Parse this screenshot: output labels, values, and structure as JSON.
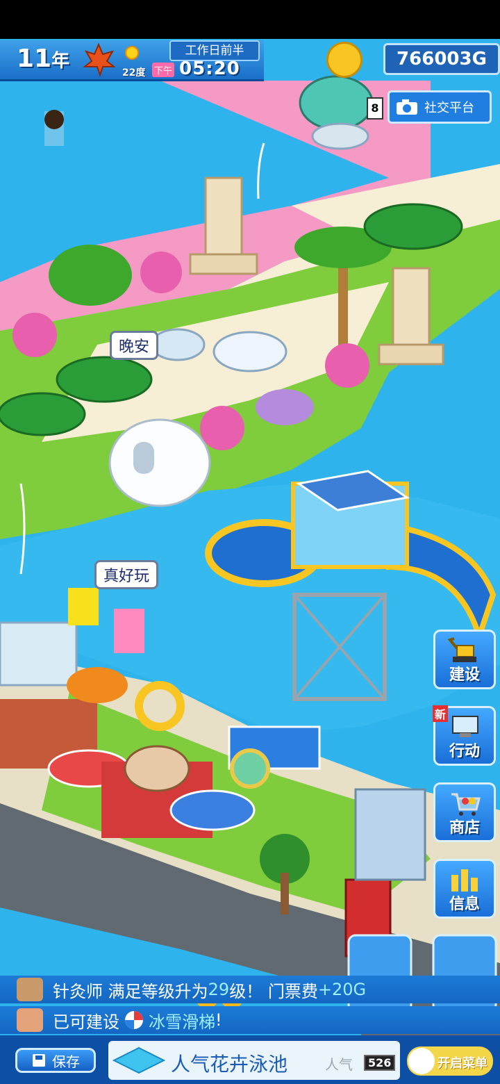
{
  "status": {
    "year": "11",
    "year_unit": "年",
    "temperature": "22度",
    "period": "工作日前半",
    "ampm": "下午",
    "time": "05:20",
    "money": "766003G"
  },
  "social": {
    "count": "8",
    "label": "社交平台"
  },
  "bubbles": [
    "晚安",
    "真好玩"
  ],
  "side_buttons": [
    {
      "label": "建设",
      "icon": "excavator-icon"
    },
    {
      "label": "行动",
      "icon": "computer-icon",
      "badge": "新"
    },
    {
      "label": "商店",
      "icon": "shopping-cart-icon"
    },
    {
      "label": "信息",
      "icon": "chart-icon"
    }
  ],
  "messages": [
    {
      "pre": "针灸师 满足等级升为",
      "hl1": "29",
      "mid": "级！ 门票费",
      "hl2": "+20G"
    },
    {
      "pre": "已可建设 ",
      "hl1": "冰雪滑梯",
      "mid": "!"
    }
  ],
  "bottom": {
    "save": "保存",
    "pool_name": "人气花卉泳池",
    "popularity_label": "人气",
    "popularity_value": "526",
    "menu_toggle": "开启菜单"
  },
  "colors": {
    "water": "#2fb3ec",
    "grass": "#7fcc3c",
    "deck": "#f4ecd2",
    "ui_blue": "#1f6fd0"
  }
}
